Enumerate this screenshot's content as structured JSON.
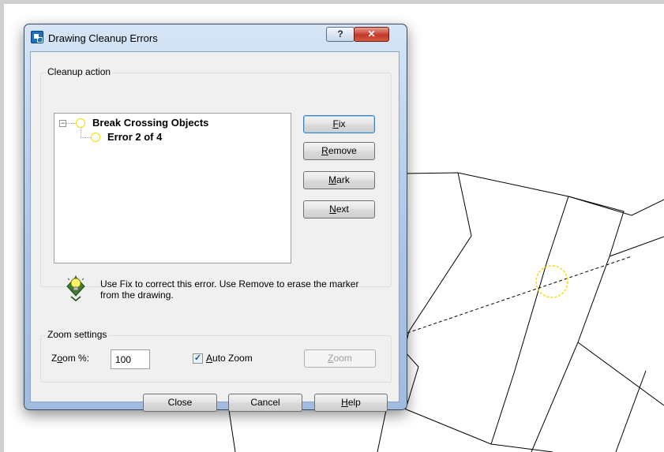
{
  "dialog": {
    "title": "Drawing Cleanup Errors",
    "caption_help": "?",
    "caption_close": "✕"
  },
  "cleanup": {
    "group_label": "Cleanup action",
    "tree": {
      "parent": "Break Crossing Objects",
      "child": "Error 2 of 4",
      "expander": "−"
    },
    "buttons": {
      "fix": {
        "mnemonic": "F",
        "rest": "ix"
      },
      "remove": {
        "mnemonic": "R",
        "rest": "emove"
      },
      "mark": {
        "mnemonic": "M",
        "rest": "ark"
      },
      "next": {
        "mnemonic": "N",
        "rest": "ext"
      }
    },
    "hint_icon": "lightbulb-icon",
    "hint": "Use Fix to correct this error. Use Remove to erase the  marker from the drawing."
  },
  "zoom": {
    "group_label": "Zoom settings",
    "label_pre": "Z",
    "label_mnemonic": "o",
    "label_post": "om %:",
    "value": "100",
    "auto_checked": "✓",
    "auto_mnemonic": "A",
    "auto_rest": "uto Zoom",
    "zoom_mnemonic": "Z",
    "zoom_rest": "oom"
  },
  "footer": {
    "close": "Close",
    "cancel": "Cancel",
    "help_mnemonic": "H",
    "help_rest": "elp"
  },
  "colors": {
    "marker_circle": "#f2dd00",
    "drawing_lines": "#000000",
    "close_button": "#c4382b"
  }
}
